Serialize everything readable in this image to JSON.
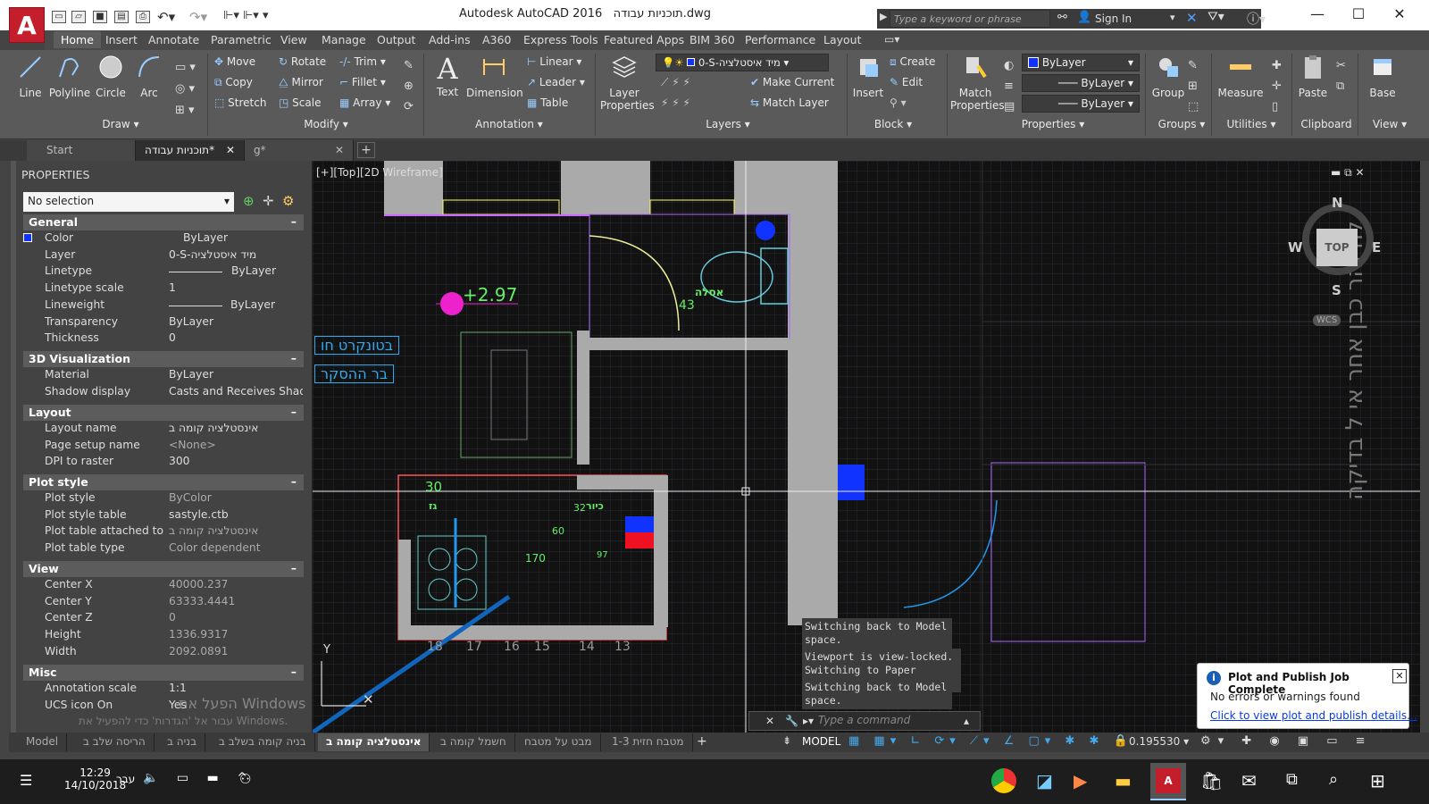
{
  "app": {
    "title": "Autodesk AutoCAD 2016",
    "doc": "תוכניות עבודה.dwg",
    "logo": "A"
  },
  "search": {
    "placeholder": "Type a keyword or phrase",
    "signin": "Sign In"
  },
  "ribbon_tabs": [
    "Home",
    "Insert",
    "Annotate",
    "Parametric",
    "View",
    "Manage",
    "Output",
    "Add-ins",
    "A360",
    "Express Tools",
    "Featured Apps",
    "BIM 360",
    "Performance",
    "Layout"
  ],
  "ribbon": {
    "draw": {
      "line": "Line",
      "polyline": "Polyline",
      "circle": "Circle",
      "arc": "Arc",
      "panel": "Draw"
    },
    "modify": {
      "move": "Move",
      "rotate": "Rotate",
      "trim": "Trim",
      "copy": "Copy",
      "mirror": "Mirror",
      "fillet": "Fillet",
      "stretch": "Stretch",
      "scale": "Scale",
      "array": "Array",
      "panel": "Modify"
    },
    "annotation": {
      "text": "Text",
      "dimension": "Dimension",
      "linear": "Linear",
      "leader": "Leader",
      "table": "Table",
      "panel": "Annotation"
    },
    "layers": {
      "props": "Layer Properties",
      "current_layer": "0-S-מיד איסטלציה",
      "make_current": "Make Current",
      "match_layer": "Match Layer",
      "panel": "Layers"
    },
    "block": {
      "insert": "Insert",
      "create": "Create",
      "edit": "Edit",
      "panel": "Block"
    },
    "properties": {
      "match": "Match Properties",
      "bylayer1": "ByLayer",
      "bylayer2": "ByLayer",
      "bylayer3": "ByLayer",
      "panel": "Properties"
    },
    "groups": {
      "group": "Group",
      "panel": "Groups"
    },
    "utilities": {
      "measure": "Measure",
      "panel": "Utilities"
    },
    "clipboard": {
      "paste": "Paste",
      "panel": "Clipboard"
    },
    "view": {
      "base": "Base",
      "panel": "View"
    }
  },
  "doc_tabs": [
    "Start",
    "תוכניות עבודה*",
    "g*"
  ],
  "properties": {
    "header": "PROPERTIES",
    "selection": "No selection",
    "sections": {
      "general": "General",
      "viz": "3D Visualization",
      "layout": "Layout",
      "plot": "Plot style",
      "view": "View",
      "misc": "Misc"
    },
    "general": [
      [
        "Color",
        "ByLayer"
      ],
      [
        "Layer",
        "0-S-מיד איסטלציה"
      ],
      [
        "Linetype",
        "ByLayer"
      ],
      [
        "Linetype scale",
        "1"
      ],
      [
        "Lineweight",
        "ByLayer"
      ],
      [
        "Transparency",
        "ByLayer"
      ],
      [
        "Thickness",
        "0"
      ]
    ],
    "viz": [
      [
        "Material",
        "ByLayer"
      ],
      [
        "Shadow display",
        "Casts and Receives Shado..."
      ]
    ],
    "layout": [
      [
        "Layout name",
        "אינסטלציה קומה ב"
      ],
      [
        "Page setup name",
        "<None>"
      ],
      [
        "DPI to raster",
        "300"
      ]
    ],
    "plot": [
      [
        "Plot style",
        "ByColor"
      ],
      [
        "Plot style table",
        "sastyle.ctb"
      ],
      [
        "Plot table attached to",
        "אינסטלציה קומה ב"
      ],
      [
        "Plot table type",
        "Color dependent"
      ]
    ],
    "view": [
      [
        "Center X",
        "40000.237"
      ],
      [
        "Center Y",
        "63333.4441"
      ],
      [
        "Center Z",
        "0"
      ],
      [
        "Height",
        "1336.9317"
      ],
      [
        "Width",
        "2092.0891"
      ]
    ],
    "misc": [
      [
        "Annotation scale",
        "1:1"
      ],
      [
        "UCS icon On",
        "Yes"
      ]
    ]
  },
  "viewport": {
    "label": "[+][Top][2D Wireframe]",
    "compass": {
      "n": "N",
      "s": "S",
      "e": "E",
      "w": "W",
      "top": "TOP",
      "wcs": "WCS"
    },
    "dims": {
      "elev": "+2.97",
      "d30": "30",
      "d60": "60",
      "d32": "32",
      "d170": "170",
      "d43": "43",
      "d97": "97",
      "gaz": "גז",
      "asla": "אסלה",
      "kiyor": "כיור"
    },
    "grid_nums": [
      "18",
      "17",
      "16",
      "15",
      "14",
      "13"
    ],
    "side_text": [
      "בטונקרט חו",
      "בר ההסקר"
    ],
    "right_text": "להיזהר כבן אחר אי ל בדיקה"
  },
  "messages": [
    "Switching back to Model space.",
    "Viewport is view-locked. Switching to Paper space.",
    "Switching back to Model space."
  ],
  "command": {
    "placeholder": "Type a command"
  },
  "layout_tabs": [
    "Model",
    "הריסה שלב ב",
    "בניה ב",
    "בניה קומה בשלב ב",
    "אינסטלציה קומה ב",
    "חשמל קומה ב",
    "מבט על מטבח",
    "מטבח חזית 1-3"
  ],
  "status": {
    "model": "MODEL",
    "scale": "0.195530"
  },
  "notification": {
    "title": "Plot and Publish Job Complete",
    "body": "No errors or warnings found",
    "link": "Click to view plot and publish details..."
  },
  "watermark": {
    "line1": "הפעל את Windows",
    "line2": "עבור אל 'הגדרות' כדי להפעיל את Windows."
  },
  "taskbar": {
    "time": "12:29",
    "date": "14/10/2018",
    "lang": "עבר"
  }
}
